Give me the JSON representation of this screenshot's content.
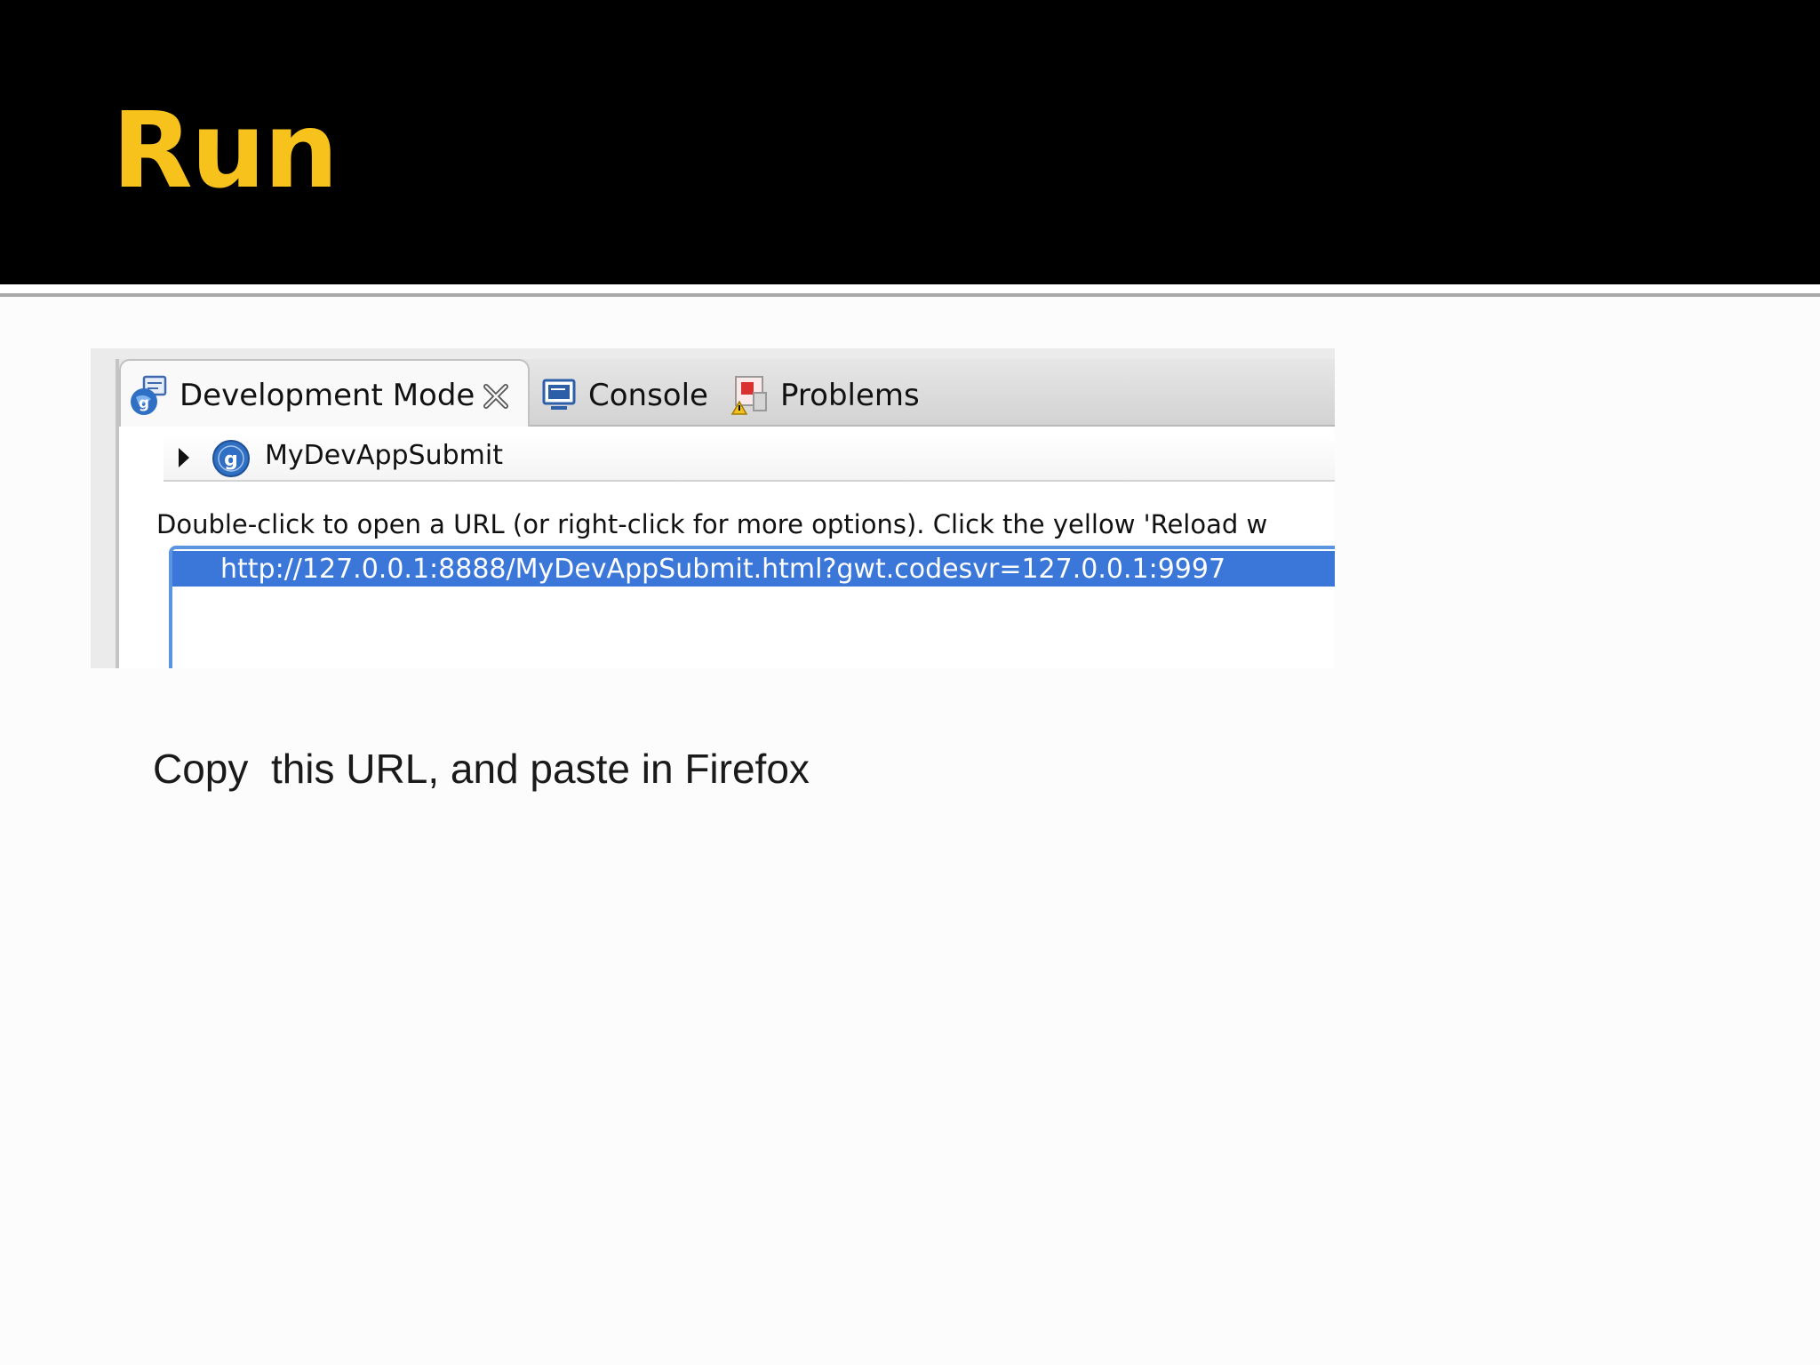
{
  "slide": {
    "title": "Run",
    "body_text": "Copy  this URL, and paste in Firefox"
  },
  "screenshot": {
    "tabs": [
      {
        "label": "Development Mode",
        "icon": "gwt-globe-icon",
        "active": true,
        "closable": true
      },
      {
        "label": "Console",
        "icon": "console-monitor-icon",
        "active": false
      },
      {
        "label": "Problems",
        "icon": "problems-icon",
        "active": false
      }
    ],
    "tree_item": {
      "label": "MyDevAppSubmit",
      "icon": "gwt-app-icon"
    },
    "hint_text": "Double-click to open a URL (or right-click for more options). Click the yellow 'Reload w",
    "url": "http://127.0.0.1:8888/MyDevAppSubmit.html?gwt.codesvr=127.0.0.1:9997"
  },
  "colors": {
    "title": "#f6c21b",
    "header_background": "#000000",
    "selection": "#3a77d8"
  }
}
